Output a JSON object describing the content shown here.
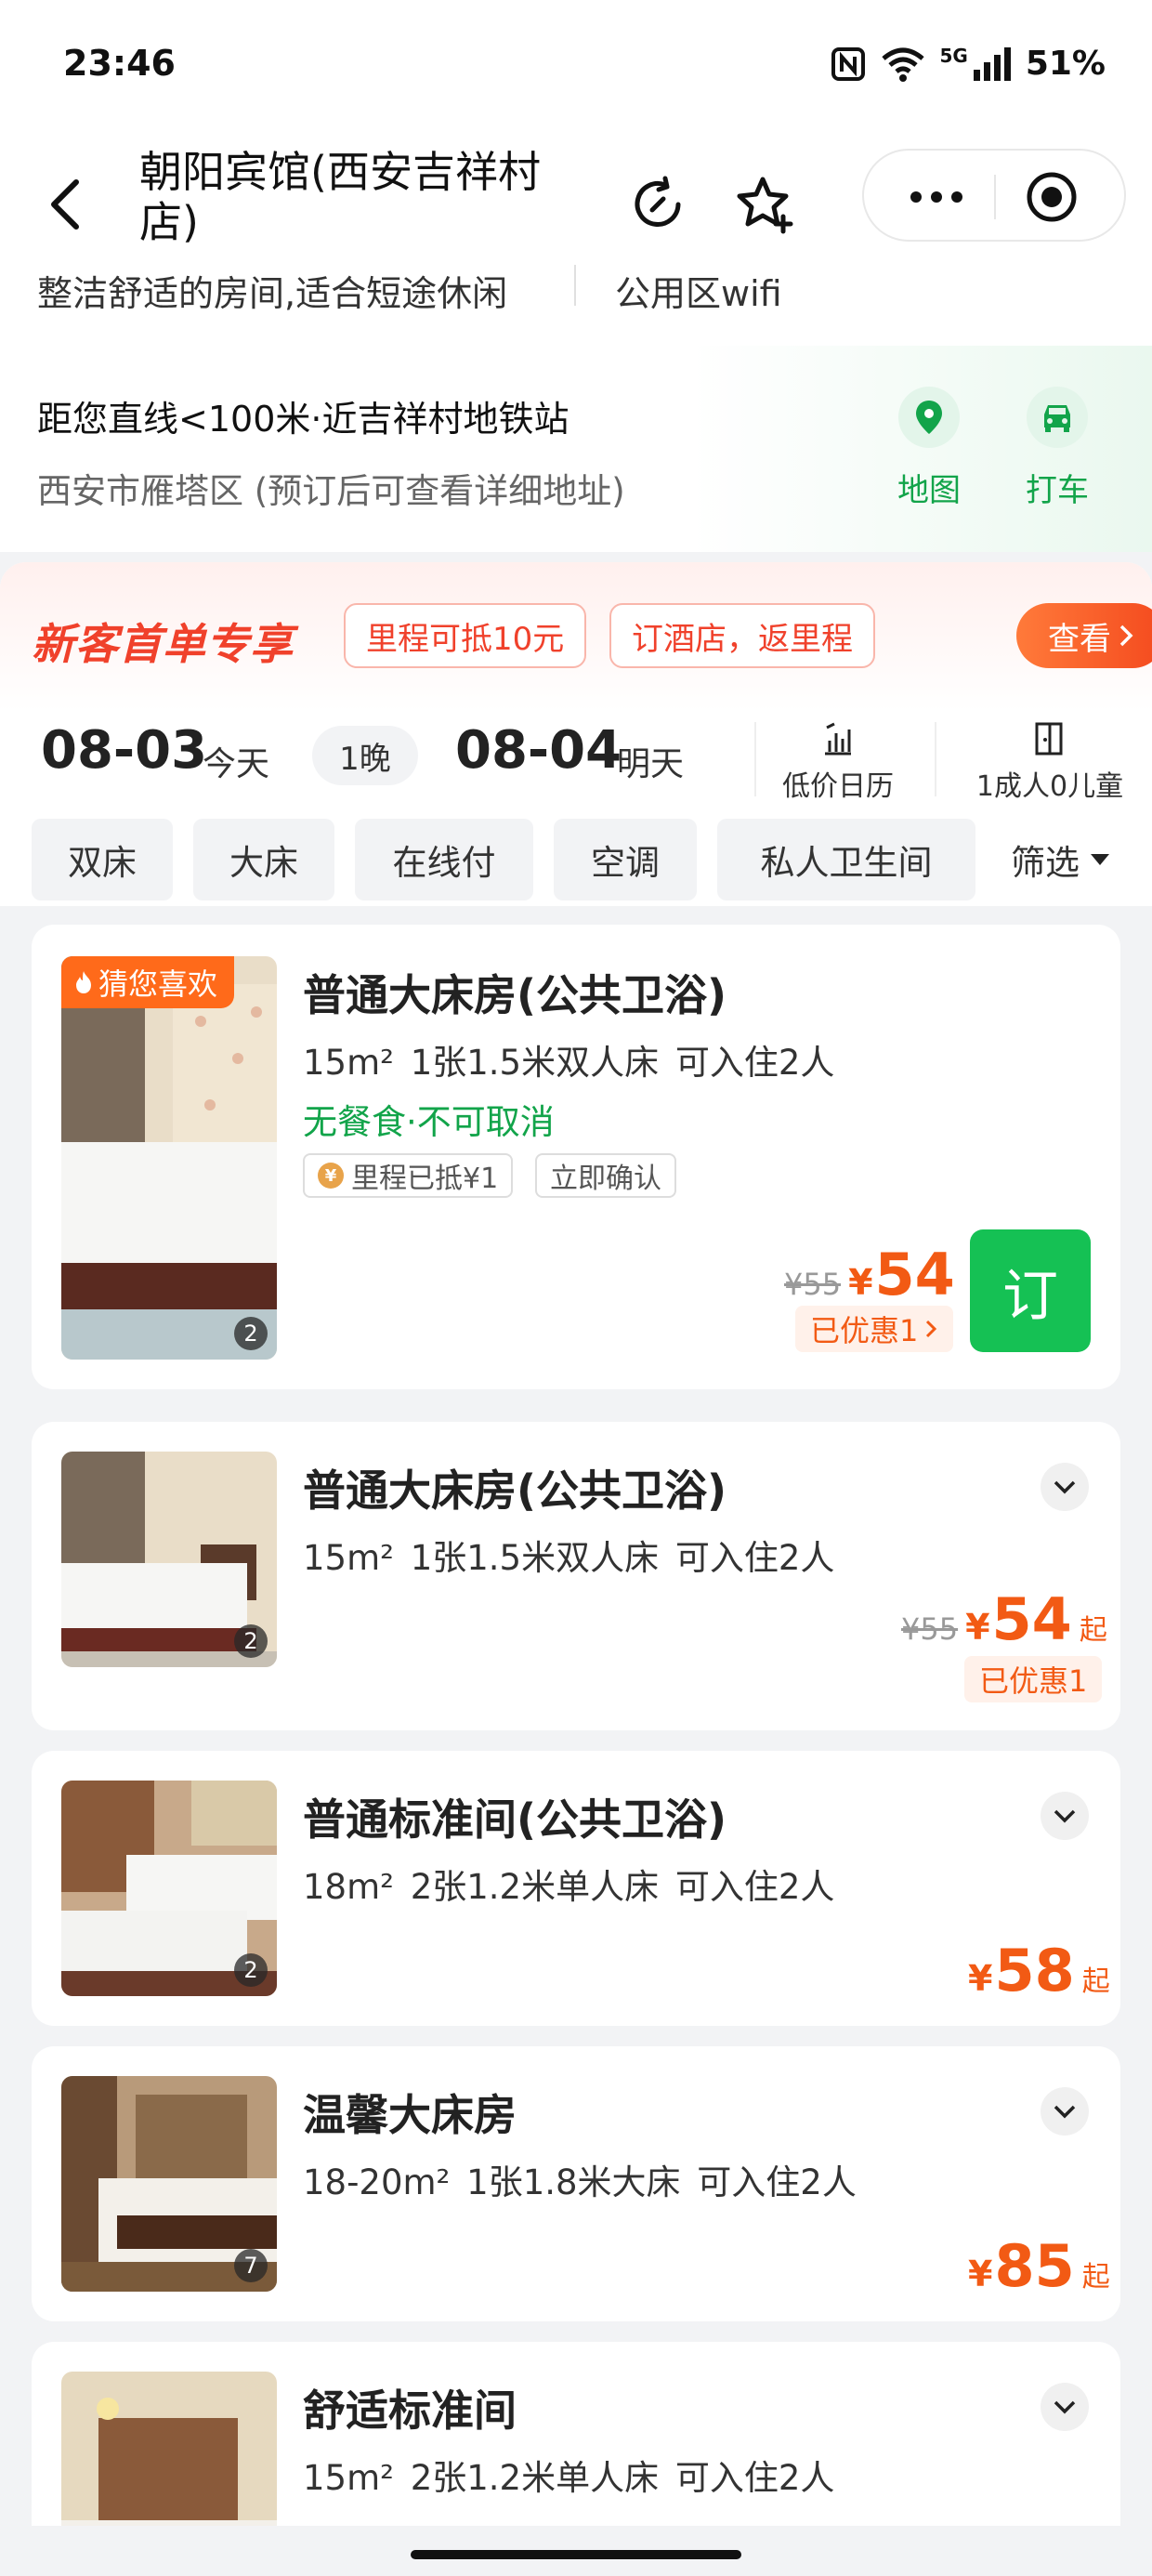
{
  "status_bar": {
    "time": "23:46",
    "network": "5G",
    "battery": "51%"
  },
  "header": {
    "title": "朝阳宾馆(西安吉祥村店)",
    "icons": [
      "back-icon",
      "refresh-icon",
      "star-add-icon",
      "more-dots-icon",
      "target-icon"
    ]
  },
  "tags": {
    "tag1": "整洁舒适的房间,适合短途休闲",
    "tag2": "公用区wifi"
  },
  "location": {
    "distance": "距您直线<100米·近吉祥村地铁站",
    "address": "西安市雁塔区 (预订后可查看详细地址)",
    "map_label": "地图",
    "taxi_label": "打车"
  },
  "promo": {
    "title": "新客首单专享",
    "pill1": "里程可抵10元",
    "pill2": "订酒店，返里程",
    "view": "查看"
  },
  "dates": {
    "checkin": "08-03",
    "checkin_label": "今天",
    "nights": "1晚",
    "checkout": "08-04",
    "checkout_label": "明天",
    "calendar": "低价日历",
    "guests": "1成人0儿童"
  },
  "filters": {
    "chips": [
      "双床",
      "大床",
      "在线付",
      "空调",
      "私人卫生间"
    ],
    "filter_label": "筛选"
  },
  "rooms": [
    {
      "fav_tag": "猜您喜欢",
      "name": "普通大床房(公共卫浴)",
      "spec": "15m²  1张1.5米双人床  可入住2人",
      "meal": "无餐食·不可取消",
      "badge1": "里程已抵¥1",
      "badge2": "立即确认",
      "orig": "¥55",
      "yen": "¥",
      "price": "54",
      "discount": "已优惠1",
      "book": "订",
      "photos": "2"
    },
    {
      "name": "普通大床房(公共卫浴)",
      "spec": "15m²  1张1.5米双人床  可入住2人",
      "orig": "¥55",
      "yen": "¥",
      "price": "54",
      "qi": "起",
      "discount": "已优惠1",
      "photos": "2"
    },
    {
      "name": "普通标准间(公共卫浴)",
      "spec": "18m²  2张1.2米单人床  可入住2人",
      "yen": "¥",
      "price": "58",
      "qi": "起",
      "photos": "2"
    },
    {
      "name": "温馨大床房",
      "spec": "18-20m²  1张1.8米大床  可入住2人",
      "yen": "¥",
      "price": "85",
      "qi": "起",
      "photos": "7"
    },
    {
      "name": "舒适标准间",
      "spec": "15m²  2张1.2米单人床  可入住2人"
    }
  ],
  "colors": {
    "accent_green": "#15c154",
    "price_orange": "#f25a14",
    "promo_red": "#f0412b"
  }
}
